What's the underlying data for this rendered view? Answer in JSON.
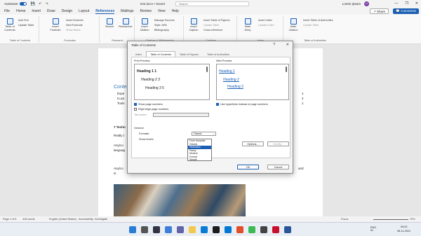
{
  "titlebar": {
    "autosave_label": "AutoSave",
    "autosave_state": "On",
    "doc_title": "test.docx • Saved",
    "search_placeholder": "Search",
    "user_name": "Lorem Ipsum",
    "avatar_initials": "LI",
    "minimize": "—",
    "maximize": "❐",
    "close": "✕"
  },
  "tabs": [
    "File",
    "Home",
    "Insert",
    "Draw",
    "Design",
    "Layout",
    "References",
    "Mailings",
    "Review",
    "View",
    "Help"
  ],
  "active_tab": "References",
  "share_label": "Share",
  "comments_label": "Comments",
  "ribbon": {
    "toc": {
      "btn": "Table of Contents",
      "add_text": "Add Text",
      "update": "Update Table",
      "label": "Table of Contents"
    },
    "footnotes": {
      "insert": "Insert Footnote",
      "endnote": "Insert Endnote",
      "next": "Next Footnote",
      "show": "Show Notes",
      "label": "Footnotes"
    },
    "research": {
      "search": "Search",
      "researcher": "Researcher",
      "label": "Research"
    },
    "citations": {
      "insert": "Insert Citation",
      "manage": "Manage Sources",
      "style": "Style: APA",
      "biblio": "Bibliography",
      "label": "Citations & Bibliography"
    },
    "captions": {
      "insert": "Insert Caption",
      "tof": "Insert Table of Figures",
      "update": "Update Table",
      "cross": "Cross-reference",
      "label": "Captions"
    },
    "index": {
      "mark": "Mark Entry",
      "insert": "Insert Index",
      "update": "Update Index",
      "label": "Index"
    },
    "toa": {
      "mark": "Mark Citation",
      "insert": "Insert Table of Authorities",
      "update": "Update Table",
      "label": "Table of Authorities"
    }
  },
  "document": {
    "toc_heading": "Conte",
    "toc_lines": [
      "Expe",
      "to pa",
      "Tools"
    ],
    "toc_pages": [
      "1",
      "2",
      "1"
    ],
    "section": "7 Techn",
    "lines": [
      "Really t",
      "Any/co",
      "languag",
      "Any/co",
      "is"
    ],
    "right_frag": "and"
  },
  "dialog": {
    "title": "Table of Contents",
    "help": "?",
    "close": "✕",
    "tabs": [
      "Index",
      "Table of Contents",
      "Table of Figures",
      "Table of Authorities"
    ],
    "active_tab": "Table of Contents",
    "print_preview_label": "Print Preview",
    "print_preview": [
      "Heading 1 1",
      "Heading 2 3",
      "Heading 3 5"
    ],
    "web_preview_label": "Web Preview",
    "web_preview": [
      "Heading 1",
      "Heading 2",
      "Heading 3"
    ],
    "show_page_numbers": "Show page numbers",
    "right_align": "Right align page numbers",
    "tab_leader": "Tab leader:",
    "use_hyperlinks": "Use hyperlinks instead of page numbers",
    "general": "General",
    "formats_label": "Formats:",
    "formats_value": "Classic",
    "show_levels_label": "Show levels:",
    "format_options": [
      "From template",
      "Classic",
      "Distinctive",
      "Fancy",
      "Modern",
      "Formal",
      "Simple"
    ],
    "highlighted_option": "Distinctive",
    "options_btn": "Options...",
    "modify_btn": "Modify...",
    "ok_btn": "OK",
    "cancel_btn": "Cancel"
  },
  "statusbar": {
    "page": "Page 1 of 5",
    "words": "418 words",
    "language": "English (United States)",
    "accessibility": "Accessibility: Investigate",
    "focus": "Focus",
    "zoom": "70%"
  },
  "taskbar": {
    "lang": "ENG IN",
    "time": "09:02",
    "date": "08-11-2021"
  },
  "colors": {
    "accent": "#1a5fb4"
  }
}
